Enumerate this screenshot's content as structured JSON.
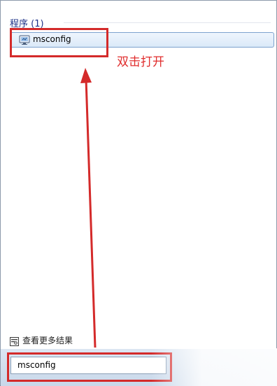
{
  "programs": {
    "header": "程序 (1)",
    "results": [
      {
        "label": "msconfig",
        "icon": "msconfig-app-icon"
      }
    ]
  },
  "annotation": {
    "text": "双击打开",
    "color": "#e02d2d"
  },
  "see_more": {
    "label": "查看更多结果",
    "icon": "search-results-icon"
  },
  "search": {
    "value": "msconfig"
  }
}
